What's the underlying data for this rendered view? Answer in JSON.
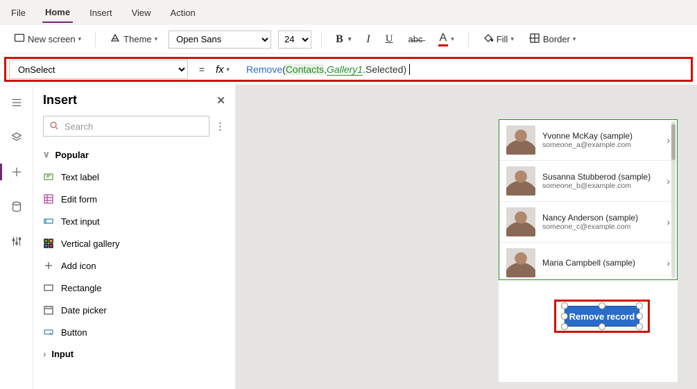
{
  "menu": {
    "items": [
      "File",
      "Home",
      "Insert",
      "View",
      "Action"
    ],
    "active": "Home"
  },
  "toolbar": {
    "new_screen": "New screen",
    "theme": "Theme",
    "font": "Open Sans",
    "font_size": "24",
    "fill_label": "Fill",
    "border_label": "Border"
  },
  "formula": {
    "property": "OnSelect",
    "fx_label": "fx",
    "tokens": {
      "remove": "Remove",
      "lp": "( ",
      "contacts": "Contacts",
      "comma": ", ",
      "gallery": "Gallery1",
      "sel": ".Selected ",
      "rp": ")"
    }
  },
  "insert": {
    "title": "Insert",
    "search_placeholder": "Search",
    "cat_popular": "Popular",
    "items": [
      "Text label",
      "Edit form",
      "Text input",
      "Vertical gallery",
      "Add icon",
      "Rectangle",
      "Date picker",
      "Button"
    ],
    "cat_input": "Input"
  },
  "gallery": {
    "rows": [
      {
        "name": "Yvonne McKay (sample)",
        "email": "someone_a@example.com"
      },
      {
        "name": "Susanna Stubberod (sample)",
        "email": "someone_b@example.com"
      },
      {
        "name": "Nancy Anderson (sample)",
        "email": "someone_c@example.com"
      },
      {
        "name": "Maria Campbell (sample)",
        "email": ""
      }
    ]
  },
  "button": {
    "label": "Remove record"
  }
}
